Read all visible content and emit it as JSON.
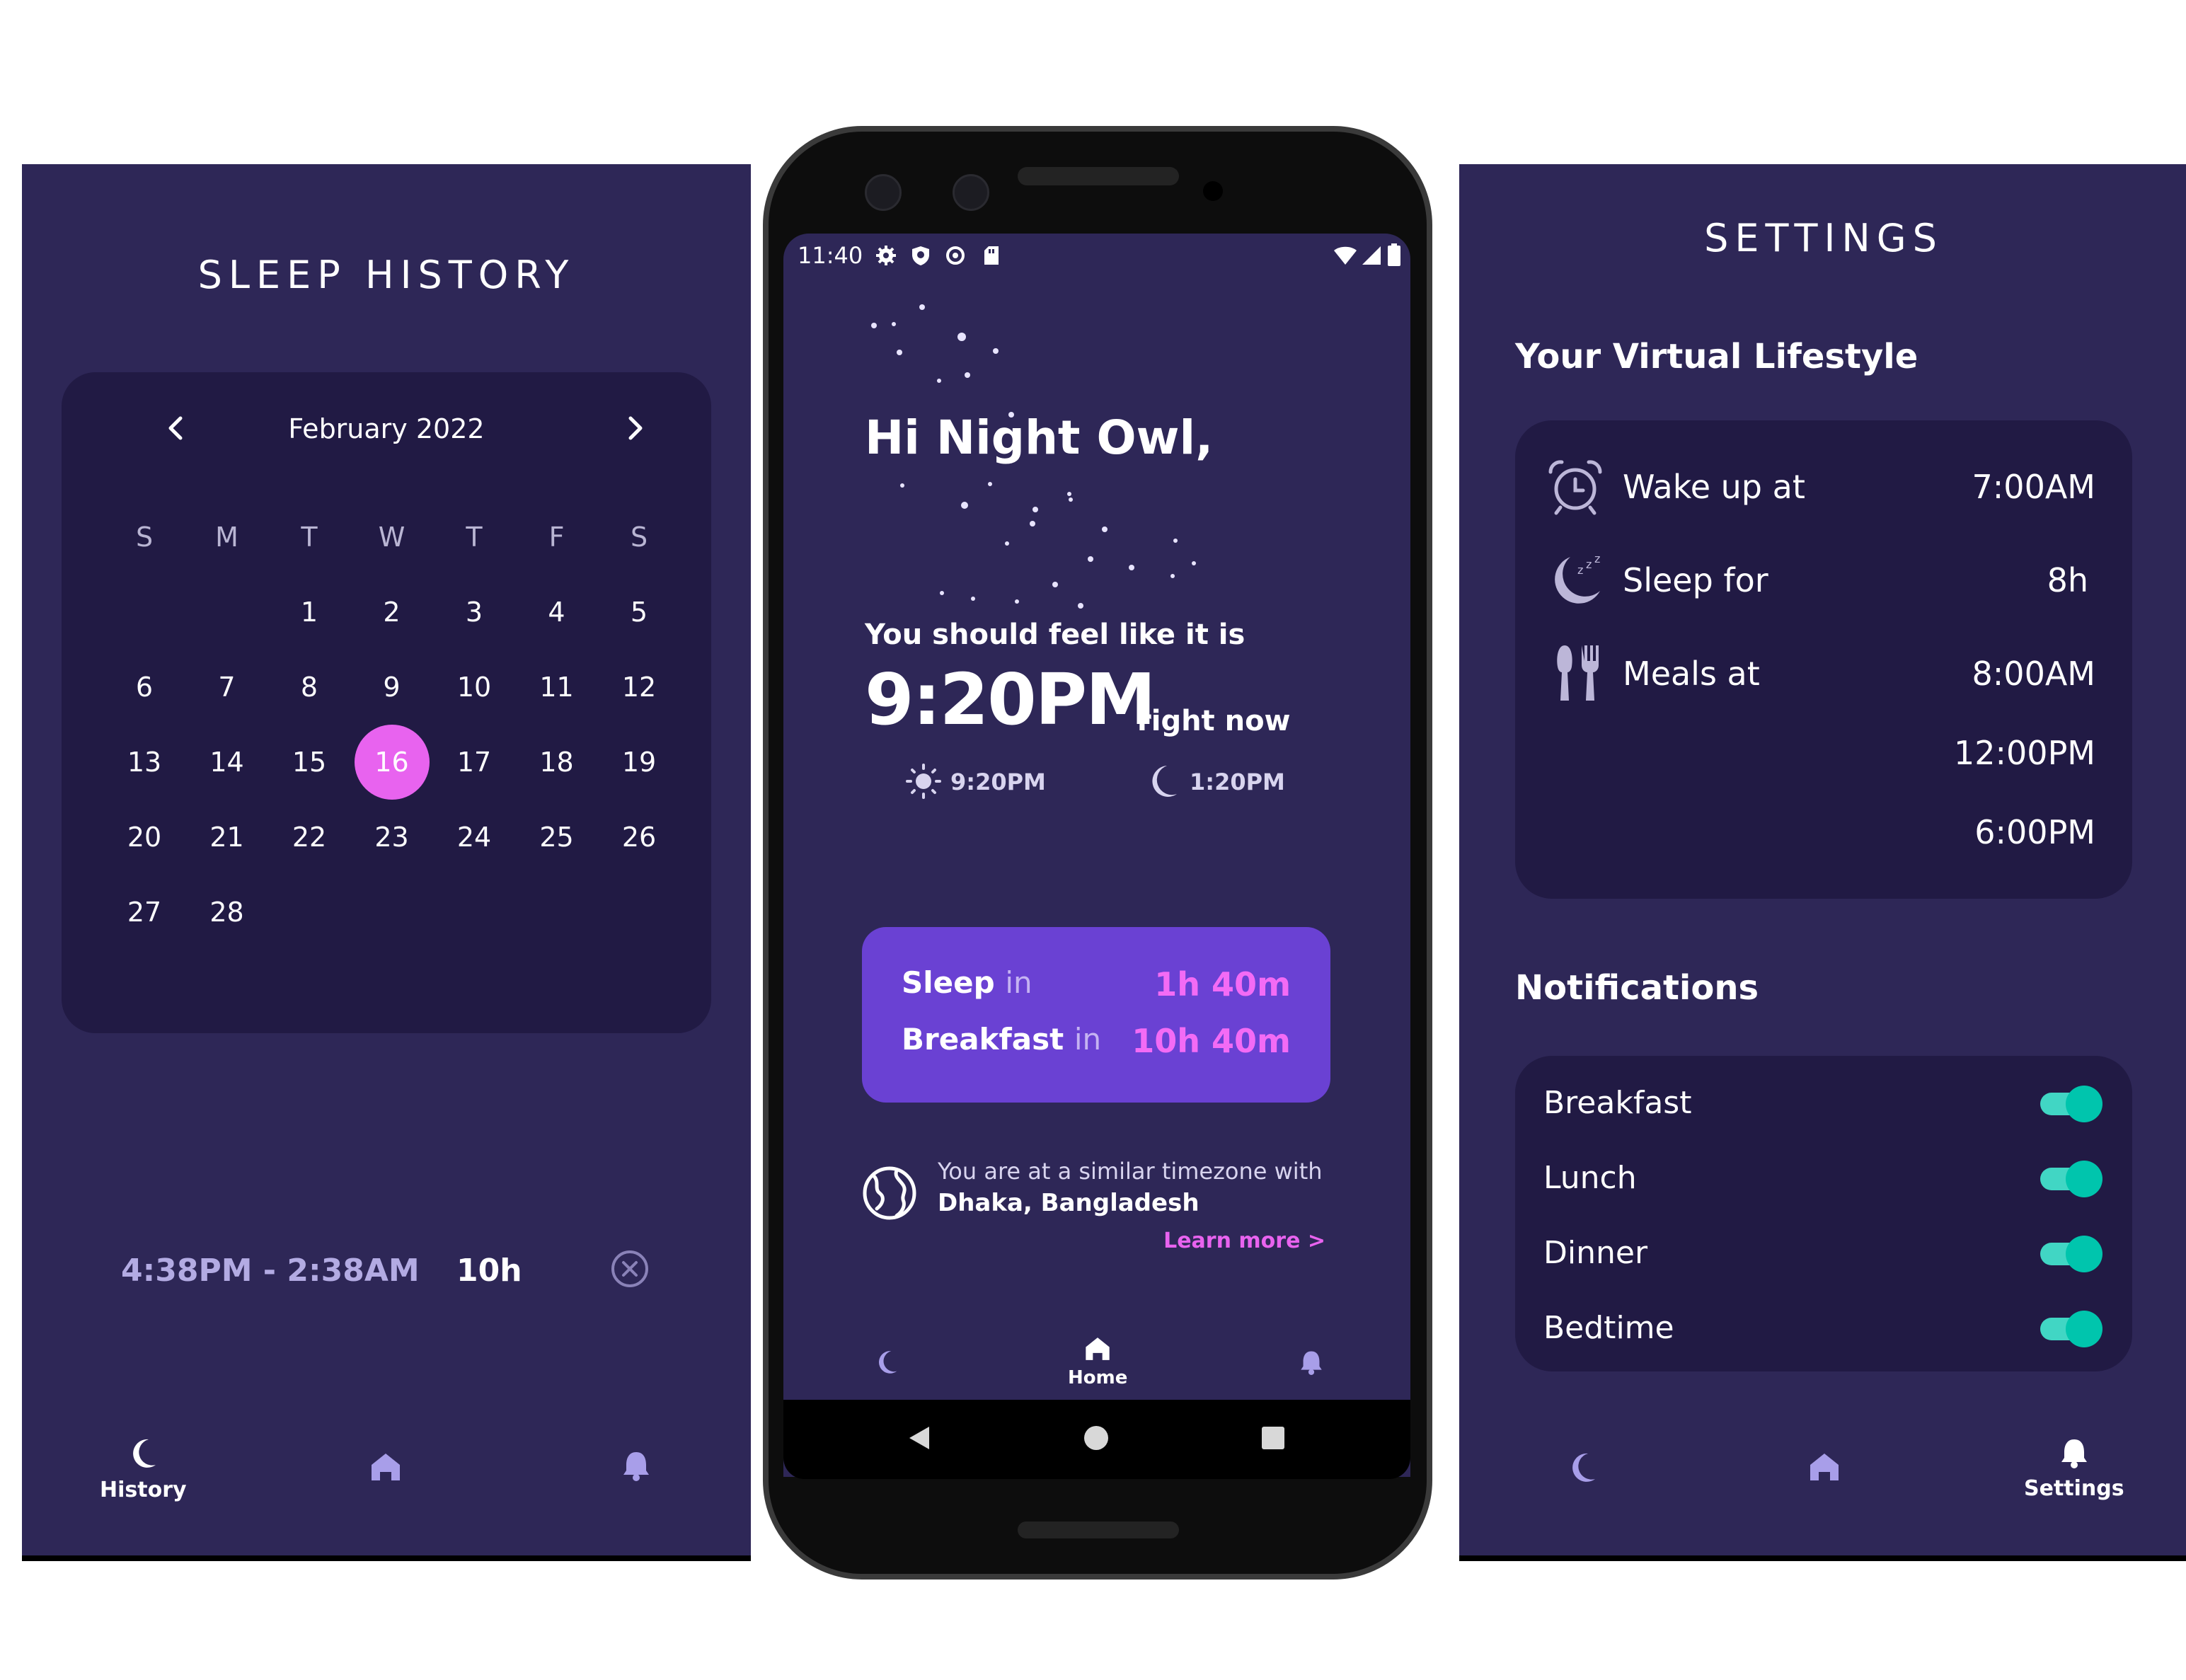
{
  "history": {
    "title": "SLEEP HISTORY",
    "calendar": {
      "month_label": "February 2022",
      "weekdays": [
        "S",
        "M",
        "T",
        "W",
        "T",
        "F",
        "S"
      ],
      "weeks": [
        [
          "",
          "",
          "1",
          "2",
          "3",
          "4",
          "5"
        ],
        [
          "6",
          "7",
          "8",
          "9",
          "10",
          "11",
          "12"
        ],
        [
          "13",
          "14",
          "15",
          "16",
          "17",
          "18",
          "19"
        ],
        [
          "20",
          "21",
          "22",
          "23",
          "24",
          "25",
          "26"
        ],
        [
          "27",
          "28",
          "",
          "",
          "",
          "",
          ""
        ]
      ],
      "selected_day": "16"
    },
    "entry": {
      "range": "4:38PM - 2:38AM",
      "duration": "10h"
    },
    "tabs": {
      "history_label": "History"
    }
  },
  "home": {
    "status_time": "11:40",
    "greeting": "Hi Night Owl,",
    "feel_label": "You should feel like it is",
    "feel_time": "9:20PM",
    "feel_suffix": "right now",
    "sun_time": "9:20PM",
    "moon_time": "1:20PM",
    "upcoming": [
      {
        "label": "Sleep",
        "joiner": "in",
        "value": "1h 40m"
      },
      {
        "label": "Breakfast",
        "joiner": "in",
        "value": "10h 40m"
      }
    ],
    "timezone_note": "You are at a similar timezone with",
    "timezone_city": "Dhaka, Bangladesh",
    "learn_more": "Learn more >",
    "tabs": {
      "home_label": "Home"
    }
  },
  "settings": {
    "title": "SETTINGS",
    "lifestyle_heading": "Your Virtual Lifestyle",
    "lifestyle": {
      "wake_label": "Wake up at",
      "wake_value": "7:00AM",
      "sleep_label": "Sleep for",
      "sleep_value": "8h",
      "meals_label": "Meals at",
      "meals_values": [
        "8:00AM",
        "12:00PM",
        "6:00PM"
      ]
    },
    "notifications_heading": "Notifications",
    "notifications": [
      {
        "label": "Breakfast",
        "on": true
      },
      {
        "label": "Lunch",
        "on": true
      },
      {
        "label": "Dinner",
        "on": true
      },
      {
        "label": "Bedtime",
        "on": true
      }
    ],
    "tabs": {
      "settings_label": "Settings"
    }
  },
  "colors": {
    "background": "#2e2757",
    "card": "#211a44",
    "accent_pink": "#e863ef",
    "accent_purple": "#6a41d3",
    "toggle_teal": "#00c5ad",
    "tab_icon": "#a89ee9"
  }
}
